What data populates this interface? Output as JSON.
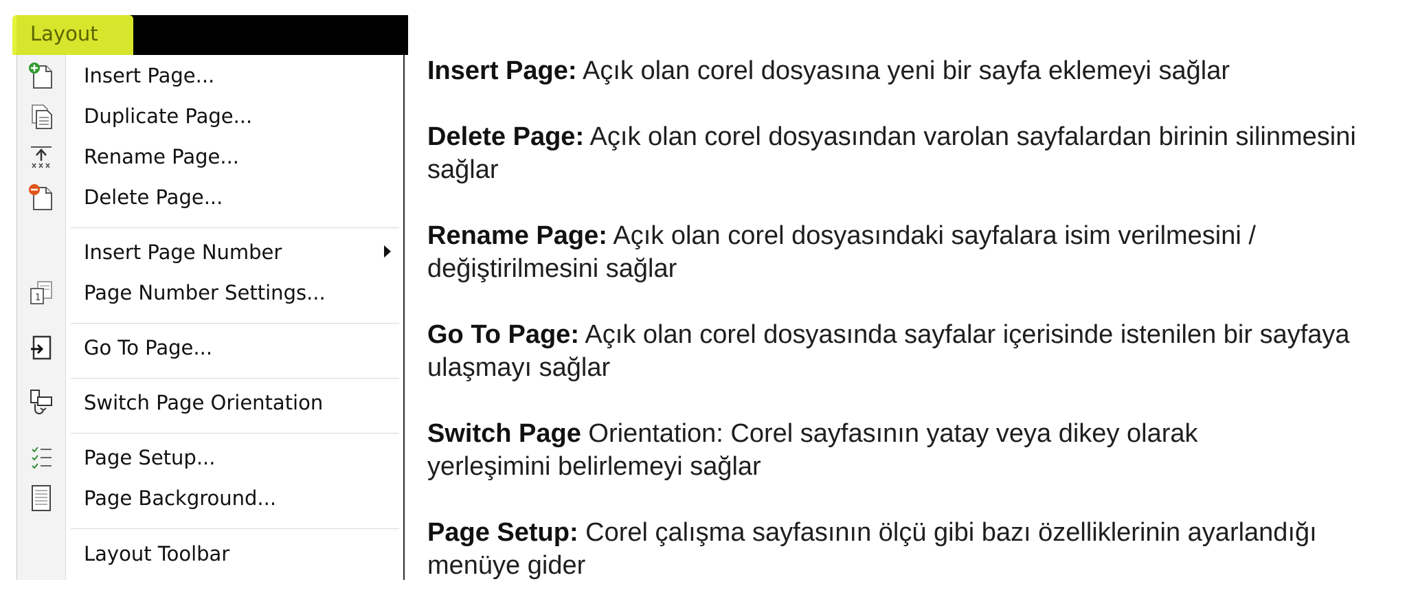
{
  "menubar": {
    "title": "Layout"
  },
  "menu": {
    "items": [
      {
        "label": "Insert Page...",
        "icon": "insert-page-icon"
      },
      {
        "label": "Duplicate Page...",
        "icon": "duplicate-page-icon"
      },
      {
        "label": "Rename Page...",
        "icon": "rename-page-icon"
      },
      {
        "label": "Delete Page...",
        "icon": "delete-page-icon"
      },
      {
        "label": "Insert Page Number",
        "icon": "submenu-arrow-icon"
      },
      {
        "label": "Page Number Settings...",
        "icon": "page-number-settings-icon"
      },
      {
        "label": "Go To Page...",
        "icon": "go-to-page-icon"
      },
      {
        "label": "Switch Page Orientation",
        "icon": "switch-orientation-icon"
      },
      {
        "label": "Page Setup...",
        "icon": "page-setup-icon"
      },
      {
        "label": "Page Background...",
        "icon": "page-background-icon"
      },
      {
        "label": "Layout Toolbar",
        "icon": ""
      }
    ]
  },
  "descriptions": [
    {
      "term": "Insert Page:",
      "text": " Açık olan corel dosyasına yeni bir sayfa eklemeyi sağlar"
    },
    {
      "term": "Delete Page:",
      "text": " Açık olan corel dosyasından varolan sayfalardan birinin silinmesini sağlar"
    },
    {
      "term": "Rename Page:",
      "text": " Açık olan corel dosyasındaki sayfalara isim verilmesini / değiştirilmesini sağlar"
    },
    {
      "term": "Go To Page:",
      "text": " Açık olan corel dosyasında sayfalar içerisinde istenilen bir sayfaya ulaşmayı sağlar"
    },
    {
      "term": "Switch Page",
      "text": " Orientation: Corel sayfasının yatay veya dikey olarak yerleşimini belirlemeyi sağlar"
    },
    {
      "term": "Page Setup:",
      "text": " Corel çalışma sayfasının ölçü gibi bazı özelliklerinin ayarlandığı menüye gider"
    }
  ],
  "colors": {
    "highlight": "#e3f22f",
    "menubar": "#000000"
  }
}
